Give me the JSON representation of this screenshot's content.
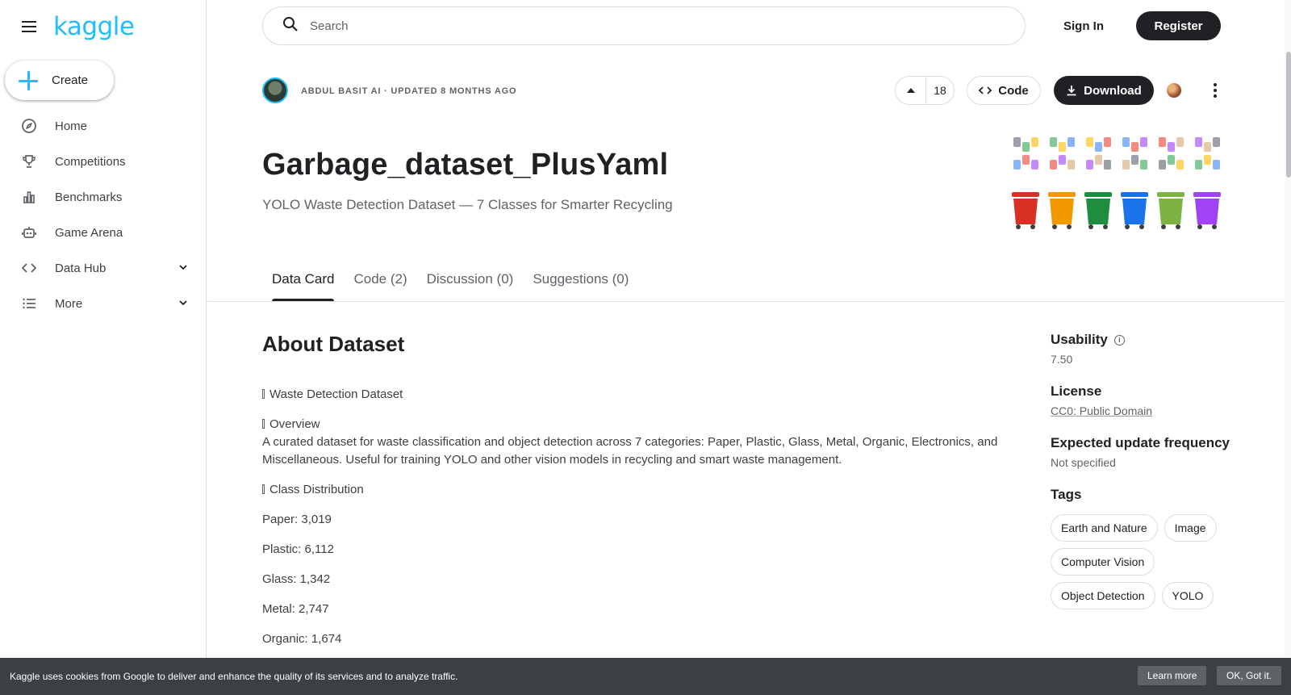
{
  "sidebar": {
    "logo": "kaggle",
    "create_label": "Create",
    "items": [
      {
        "label": "Home",
        "icon": "compass-icon"
      },
      {
        "label": "Competitions",
        "icon": "trophy-icon"
      },
      {
        "label": "Benchmarks",
        "icon": "bar-chart-icon"
      },
      {
        "label": "Game Arena",
        "icon": "robot-icon"
      },
      {
        "label": "Data Hub",
        "icon": "code-icon"
      },
      {
        "label": "More",
        "icon": "list-icon"
      }
    ]
  },
  "header": {
    "search_placeholder": "Search",
    "signin_label": "Sign In",
    "register_label": "Register"
  },
  "dataset": {
    "author_line": "ABDUL BASIT AI · UPDATED 8 MONTHS AGO",
    "votes": "18",
    "code_label": "Code",
    "download_label": "Download",
    "title": "Garbage_dataset_PlusYaml",
    "subtitle": "YOLO Waste Detection Dataset — 7 Classes for Smarter Recycling"
  },
  "tabs": [
    {
      "label": "Data Card"
    },
    {
      "label": "Code (2)"
    },
    {
      "label": "Discussion (0)"
    },
    {
      "label": "Suggestions (0)"
    }
  ],
  "content": {
    "about_title": "About Dataset",
    "heading1": "Waste Detection Dataset",
    "overview_heading": "Overview",
    "overview_text": "A curated dataset for waste classification and object detection across 7 categories: Paper, Plastic, Glass, Metal, Organic, Electronics, and Miscellaneous. Useful for training YOLO and other vision models in recycling and smart waste management.",
    "class_heading": "Class Distribution",
    "classes": [
      "Paper: 3,019",
      "Plastic: 6,112",
      "Glass: 1,342",
      "Metal: 2,747",
      "Organic: 1,674"
    ]
  },
  "side": {
    "usability_label": "Usability",
    "usability_value": "7.50",
    "license_label": "License",
    "license_value": "CC0: Public Domain",
    "update_label": "Expected update frequency",
    "update_value": "Not specified",
    "tags_label": "Tags",
    "tags": [
      "Earth and Nature",
      "Image",
      "Computer Vision",
      "Object Detection",
      "YOLO"
    ]
  },
  "cookie": {
    "text": "Kaggle uses cookies from Google to deliver and enhance the quality of its services and to analyze traffic.",
    "learn_more": "Learn more",
    "ok": "OK, Got it."
  },
  "colors": {
    "brand": "#20beff",
    "primary_dark": "#202124",
    "bins": [
      "#d93025",
      "#f29900",
      "#1e8e3e",
      "#1a73e8",
      "#7cb342",
      "#a142f4"
    ]
  }
}
